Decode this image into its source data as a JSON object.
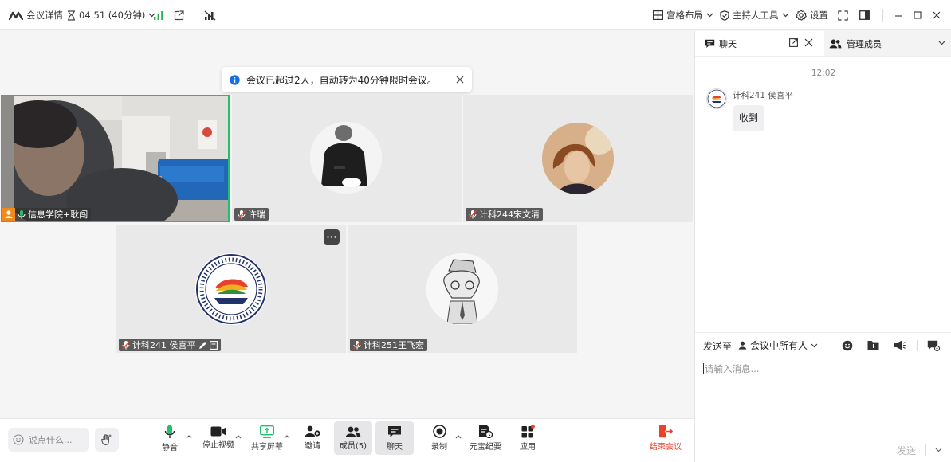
{
  "topbar": {
    "meeting_info": "会议详情",
    "timer": "04:51 (40分钟)",
    "layout": "宫格布局",
    "host_tools": "主持人工具",
    "settings": "设置"
  },
  "toast": {
    "message": "会议已超过2人，自动转为40分钟限时会议。"
  },
  "participants": [
    {
      "name": "信息学院+耿闯"
    },
    {
      "name": "许瑞"
    },
    {
      "name": "计科244宋文清"
    },
    {
      "name": "计科241 侯喜平"
    },
    {
      "name": "计科251王飞宏"
    }
  ],
  "toolbar": {
    "say_something": "说点什么...",
    "mute": "静音",
    "stop_video": "停止视频",
    "share_screen": "共享屏幕",
    "invite": "邀请",
    "members": "成员(5)",
    "chat": "聊天",
    "record": "录制",
    "minutes": "元宝纪要",
    "apps": "应用",
    "end_meeting": "结束会议"
  },
  "chat_panel": {
    "tab_chat": "聊天",
    "tab_members": "管理成员",
    "time": "12:02",
    "messages": [
      {
        "sender": "计科241 侯喜平",
        "text": "收到"
      }
    ],
    "send_to_label": "发送至",
    "send_to_target": "会议中所有人",
    "input_placeholder": "请输入消息...",
    "send_label": "发送"
  },
  "colors": {
    "accent_green": "#1fc26b",
    "end_red": "#e8412c",
    "info_blue": "#1a6fe8",
    "signal_green": "#22b34c"
  }
}
